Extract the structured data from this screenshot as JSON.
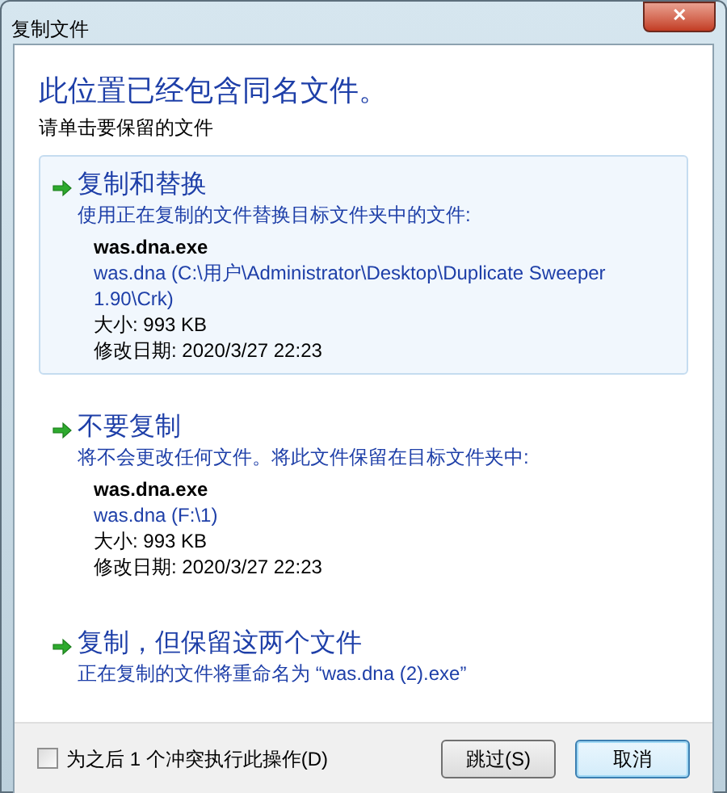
{
  "window": {
    "title": "复制文件",
    "close": "✕"
  },
  "heading": "此位置已经包含同名文件。",
  "subheading": "请单击要保留的文件",
  "options": [
    {
      "selected": true,
      "title": "复制和替换",
      "description": "使用正在复制的文件替换目标文件夹中的文件:",
      "file": {
        "name": "was.dna.exe",
        "location": "was.dna (C:\\用户\\Administrator\\Desktop\\Duplicate Sweeper 1.90\\Crk)",
        "size": "大小: 993 KB",
        "modified": "修改日期: 2020/3/27 22:23"
      }
    },
    {
      "selected": false,
      "title": "不要复制",
      "description": "将不会更改任何文件。将此文件保留在目标文件夹中:",
      "file": {
        "name": "was.dna.exe",
        "location": "was.dna (F:\\1)",
        "size": "大小: 993 KB",
        "modified": "修改日期: 2020/3/27 22:23"
      }
    },
    {
      "selected": false,
      "title": "复制，但保留这两个文件",
      "description": "正在复制的文件将重命名为 “was.dna (2).exe”"
    }
  ],
  "apply_all": {
    "label": "为之后 1 个冲突执行此操作(D)",
    "checked": false
  },
  "buttons": [
    {
      "label": "跳过(S)",
      "focused": false
    },
    {
      "label": "取消",
      "focused": true
    }
  ]
}
